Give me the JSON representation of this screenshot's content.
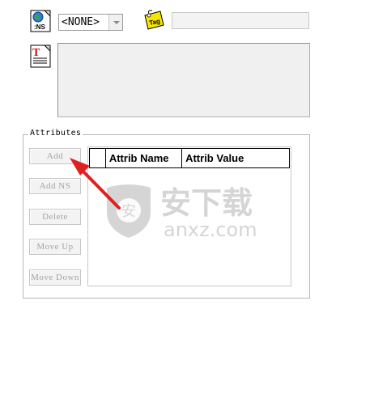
{
  "namespace": {
    "selected": "<NONE>",
    "icon_label": ":NS"
  },
  "tag": {
    "icon_label": "Tag",
    "value": ""
  },
  "text": {
    "value": ""
  },
  "attributes": {
    "group_label": "Attributes",
    "buttons": {
      "add": "Add",
      "add_ns": "Add NS",
      "delete": "Delete",
      "move_up": "Move Up",
      "move_down": "Move Down"
    },
    "columns": [
      "",
      "Attrib Name",
      "Attrib Value"
    ],
    "rows": []
  },
  "watermark": {
    "text_cn": "安下载",
    "text_en": "anxz.com",
    "badge_char": "安"
  },
  "colors": {
    "accent_arrow": "#e02020",
    "disabled_text": "#a3a3a3",
    "panel_bg": "#f0f0f0"
  }
}
